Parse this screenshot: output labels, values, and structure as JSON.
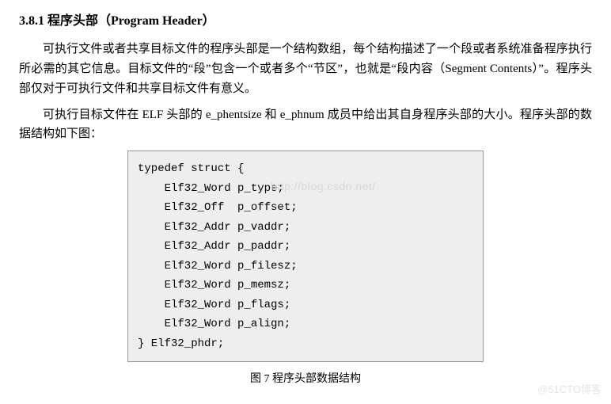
{
  "heading": "3.8.1 程序头部（Program Header）",
  "para1": "可执行文件或者共享目标文件的程序头部是一个结构数组，每个结构描述了一个段或者系统准备程序执行所必需的其它信息。目标文件的“段”包含一个或者多个“节区”，也就是“段内容（Segment Contents）”。程序头部仅对于可执行文件和共享目标文件有意义。",
  "para2": "可执行目标文件在 ELF 头部的 e_phentsize 和 e_phnum 成员中给出其自身程序头部的大小。程序头部的数据结构如下图：",
  "code": "typedef struct {\n    Elf32_Word p_type;\n    Elf32_Off  p_offset;\n    Elf32_Addr p_vaddr;\n    Elf32_Addr p_paddr;\n    Elf32_Word p_filesz;\n    Elf32_Word p_memsz;\n    Elf32_Word p_flags;\n    Elf32_Word p_align;\n} Elf32_phdr;",
  "code_watermark": "http://blog.csdn.net/",
  "figcaption": "图 7 程序头部数据结构",
  "corner_watermark": "@51CTO博客"
}
